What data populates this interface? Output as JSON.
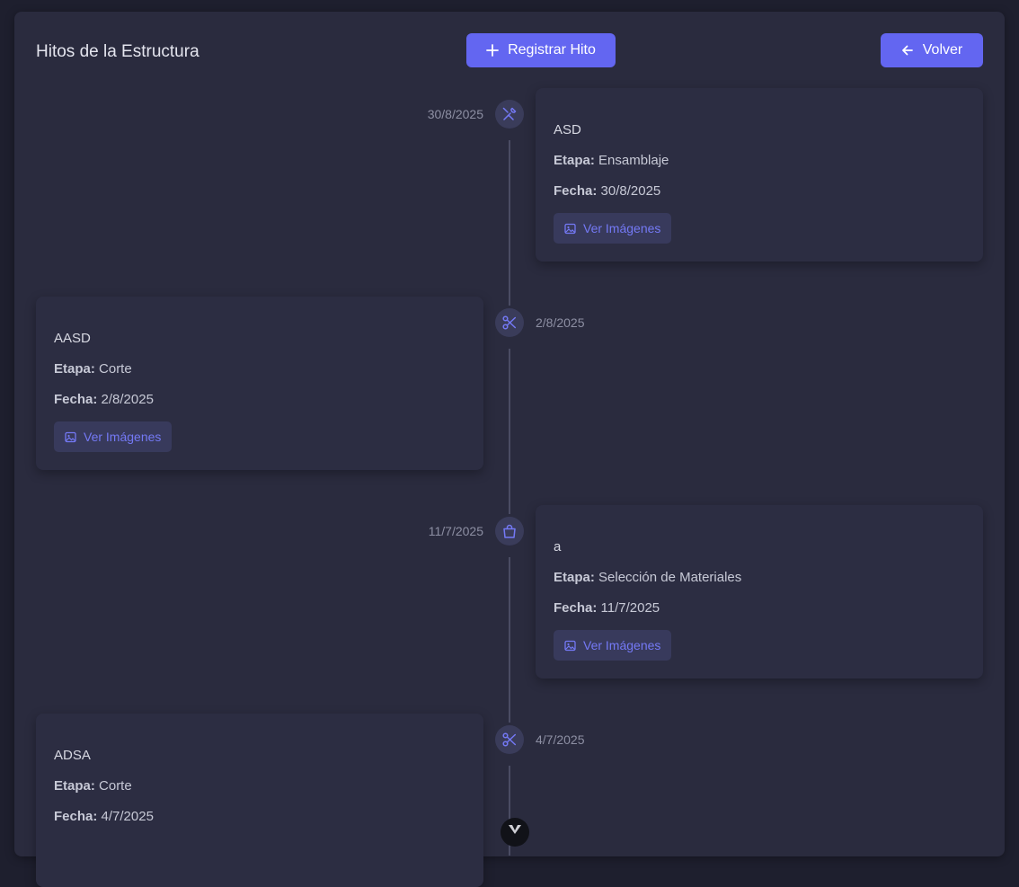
{
  "header": {
    "title": "Hitos de la Estructura",
    "register_label": "Registrar Hito",
    "back_label": "Volver"
  },
  "labels": {
    "stage": "Etapa:",
    "date": "Fecha:",
    "images_button": "Ver Imágenes"
  },
  "milestones": [
    {
      "name": "ASD",
      "stage": "Ensamblaje",
      "date": "30/8/2025",
      "icon": "tools-icon",
      "side": "right"
    },
    {
      "name": "AASD",
      "stage": "Corte",
      "date": "2/8/2025",
      "icon": "scissors-icon",
      "side": "left"
    },
    {
      "name": "a",
      "stage": "Selección de Materiales",
      "date": "11/7/2025",
      "icon": "shopping-bag-icon",
      "side": "right"
    },
    {
      "name": "ADSA",
      "stage": "Corte",
      "date": "4/7/2025",
      "icon": "scissors-icon",
      "side": "left"
    }
  ],
  "colors": {
    "accent": "#6366f1",
    "background": "#1e1f2e",
    "panel": "#2a2b3e",
    "card": "#2c2d42"
  }
}
